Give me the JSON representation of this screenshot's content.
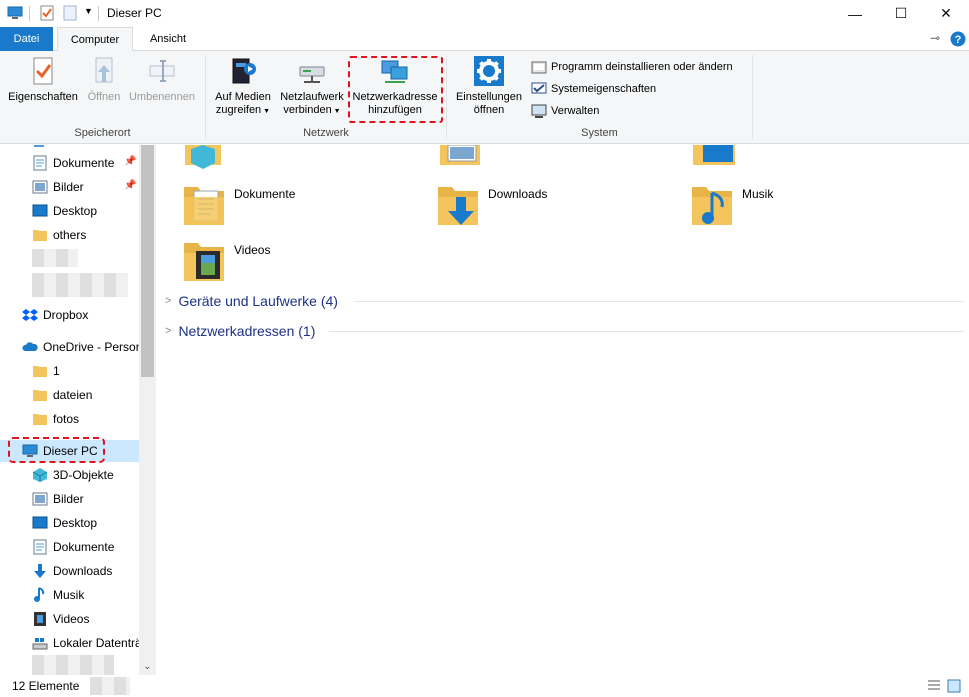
{
  "window": {
    "title": "Dieser PC"
  },
  "controls": {
    "minimize": "—",
    "maximize": "☐",
    "close": "✕"
  },
  "tabs": {
    "file": "Datei",
    "computer": "Computer",
    "view": "Ansicht"
  },
  "ribbon": {
    "speicherort": {
      "label": "Speicherort",
      "properties": "Eigenschaften",
      "open": "Öffnen",
      "rename": "Umbenennen"
    },
    "netzwerk": {
      "label": "Netzwerk",
      "media_line1": "Auf Medien",
      "media_line2": "zugreifen",
      "drive_line1": "Netzlaufwerk",
      "drive_line2": "verbinden",
      "netaddr_line1": "Netzwerkadresse",
      "netaddr_line2": "hinzufügen"
    },
    "system": {
      "label": "System",
      "settings_line1": "Einstellungen",
      "settings_line2": "öffnen",
      "uninstall": "Programm deinstallieren oder ändern",
      "sysprops": "Systemeigenschaften",
      "manage": "Verwalten"
    }
  },
  "nav": {
    "items": [
      {
        "label": "Dokumente"
      },
      {
        "label": "Bilder"
      },
      {
        "label": "Desktop"
      },
      {
        "label": "others"
      },
      {
        "label": "Dropbox"
      },
      {
        "label": "OneDrive - Person"
      },
      {
        "label": "1"
      },
      {
        "label": "dateien"
      },
      {
        "label": "fotos"
      },
      {
        "label": "Dieser PC"
      },
      {
        "label": "3D-Objekte"
      },
      {
        "label": "Bilder"
      },
      {
        "label": "Desktop"
      },
      {
        "label": "Dokumente"
      },
      {
        "label": "Downloads"
      },
      {
        "label": "Musik"
      },
      {
        "label": "Videos"
      },
      {
        "label": "Lokaler Datenträ"
      }
    ]
  },
  "content": {
    "folders": [
      {
        "label": "Dokumente"
      },
      {
        "label": "Downloads"
      },
      {
        "label": "Musik"
      },
      {
        "label": "Videos"
      }
    ],
    "sections": [
      {
        "label": "Geräte und Laufwerke (4)"
      },
      {
        "label": "Netzwerkadressen (1)"
      }
    ]
  },
  "status": {
    "count": "12 Elemente"
  },
  "colors": {
    "accent": "#1979ca",
    "highlight": "#e0141e",
    "folder": "#f4c55c",
    "section": "#1e3287"
  }
}
